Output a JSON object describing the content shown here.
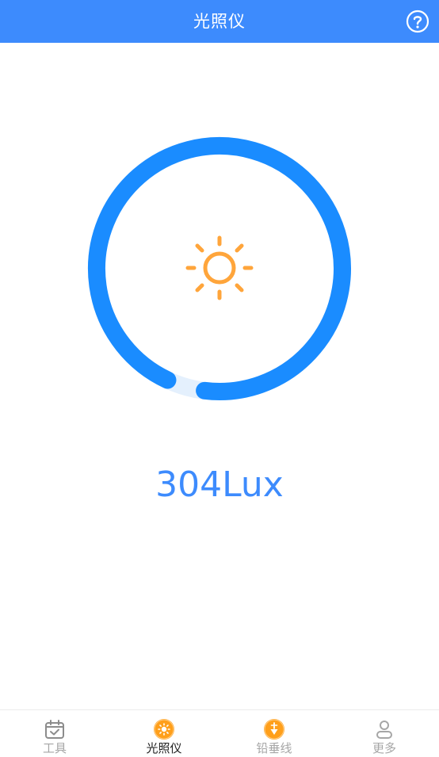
{
  "header": {
    "title": "光照仪",
    "help_icon": "question-circle-icon"
  },
  "meter": {
    "reading": "304Lux",
    "level_fraction": 0.95,
    "icon": "sun-icon",
    "colors": {
      "progress": "#1a8cff",
      "track": "#e4f0fd",
      "sun": "#ffa53b"
    }
  },
  "tabs": [
    {
      "label": "工具",
      "icon": "calendar-check-icon",
      "active": false
    },
    {
      "label": "光照仪",
      "icon": "sun-badge-icon",
      "active": true
    },
    {
      "label": "铅垂线",
      "icon": "plumb-line-badge-icon",
      "active": false
    },
    {
      "label": "更多",
      "icon": "person-icon",
      "active": false
    }
  ],
  "colors": {
    "brand": "#3d8bfd",
    "tab_active": "#222222",
    "tab_inactive": "#a6a6a6",
    "badge": "#ff9f1a"
  }
}
